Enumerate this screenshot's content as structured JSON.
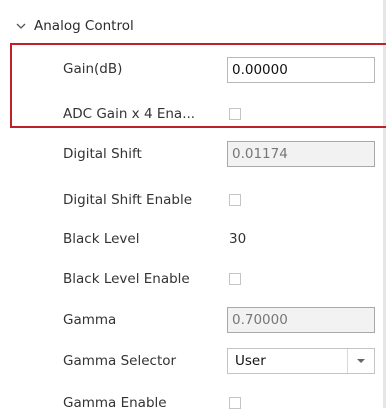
{
  "group": {
    "title": "Analog Control"
  },
  "rows": {
    "gain": {
      "label": "Gain(dB)",
      "value": "0.00000"
    },
    "adc_gain_x4": {
      "label": "ADC Gain x 4 Ena..."
    },
    "digital_shift": {
      "label": "Digital Shift",
      "value": "0.01174"
    },
    "digital_shift_enable": {
      "label": "Digital Shift Enable"
    },
    "black_level": {
      "label": "Black Level",
      "value": "30"
    },
    "black_level_enable": {
      "label": "Black Level Enable"
    },
    "gamma": {
      "label": "Gamma",
      "value": "0.70000"
    },
    "gamma_selector": {
      "label": "Gamma Selector",
      "value": "User"
    },
    "gamma_enable": {
      "label": "Gamma Enable"
    }
  },
  "colors": {
    "highlight": "#c0202a",
    "disabled_bg": "#f2f2f2"
  },
  "icons": {
    "group": "chevron-down-icon",
    "dropdown": "dropdown-arrow-icon"
  }
}
